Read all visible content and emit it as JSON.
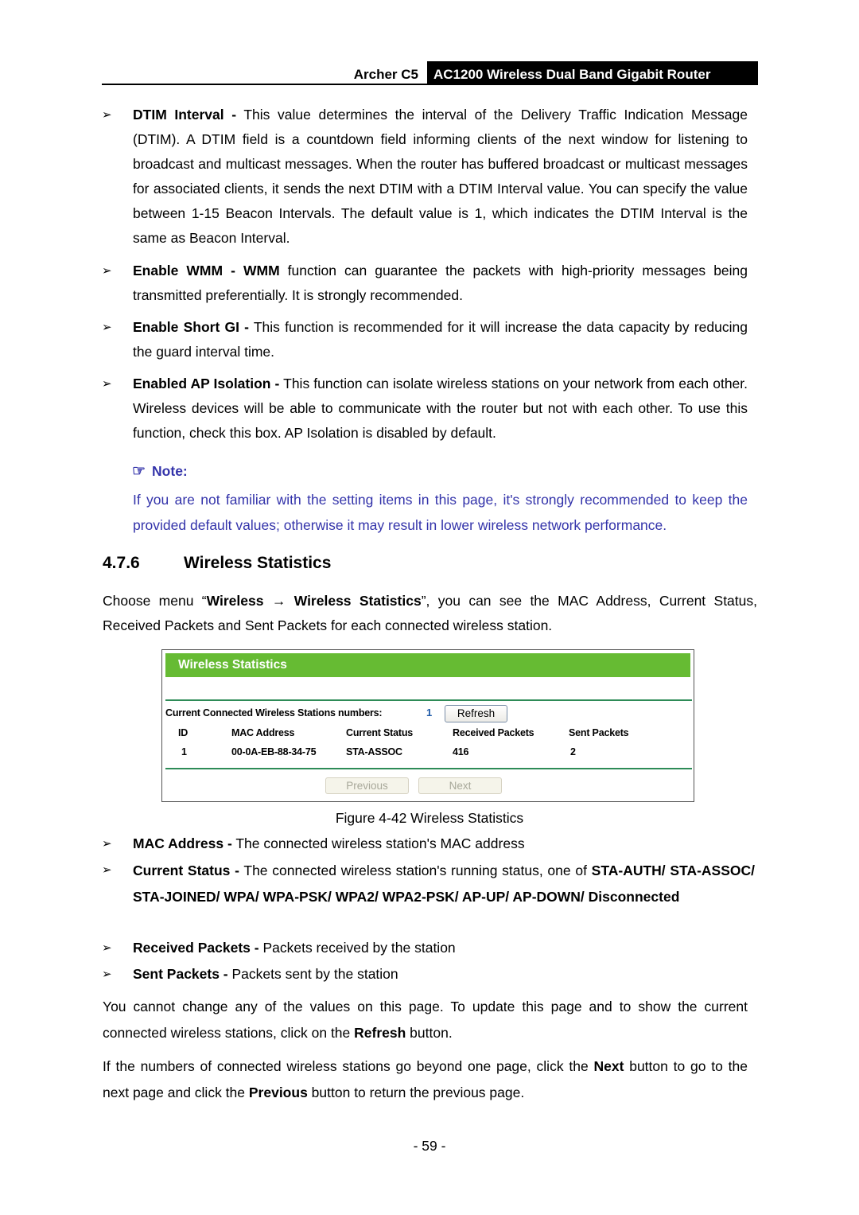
{
  "header": {
    "model": "Archer C5",
    "product": "AC1200 Wireless Dual Band Gigabit Router"
  },
  "bullets_top": [
    {
      "term": "DTIM Interval -",
      "text": " This value determines the interval of the Delivery Traffic Indication Message (DTIM). A DTIM field is a countdown field informing clients of the next window for listening to broadcast and multicast messages. When the router has buffered broadcast or multicast messages for associated clients, it sends the next DTIM with a DTIM Interval value. You can specify the value between 1-15 Beacon Intervals. The default value is 1, which indicates the DTIM Interval is the same as Beacon Interval."
    },
    {
      "term": "Enable WMM - WMM",
      "text": " function can guarantee the packets with high-priority messages being transmitted preferentially. It is strongly recommended."
    },
    {
      "term": "Enable Short GI -",
      "text": " This function is recommended for it will increase the data capacity by reducing the guard interval time."
    },
    {
      "term": "Enabled AP Isolation -",
      "text": " This function can isolate wireless stations on your network from each other. Wireless devices will be able to communicate with the router but not with each other. To use this function, check this box. AP Isolation is disabled by default."
    }
  ],
  "bullet_glyph": "➢",
  "note": {
    "icon": "☞",
    "title": "Note:",
    "text": "If you are not familiar with the setting items in this page, it's strongly recommended to keep the provided default values; otherwise it may result in lower wireless network performance.",
    "color": "#3333aa"
  },
  "section": {
    "number": "4.7.6",
    "title": "Wireless Statistics"
  },
  "intro": {
    "prefix": "Choose menu “",
    "menu_1": "Wireless",
    "arrow": " → ",
    "menu_2": "Wireless Statistics",
    "suffix": "”, you can see the MAC Address, Current Status, Received Packets and Sent Packets for each connected wireless station."
  },
  "figure": {
    "bar_title": "Wireless Statistics",
    "bar_color": "#66bb33",
    "count_label": "Current Connected Wireless Stations numbers:",
    "count_value": "1",
    "refresh_button": "Refresh",
    "columns": [
      "ID",
      "MAC Address",
      "Current Status",
      "Received Packets",
      "Sent Packets"
    ],
    "rows": [
      [
        "1",
        "00-0A-EB-88-34-75",
        "STA-ASSOC",
        "416",
        "2"
      ]
    ],
    "previous_button": "Previous",
    "next_button": "Next",
    "caption": "Figure 4-42 Wireless Statistics"
  },
  "bullets_bottom": [
    {
      "term": "MAC Address -",
      "text": " The connected wireless station's MAC address"
    },
    {
      "term": "Current Status -",
      "text": " The connected wireless station's running status, one of ",
      "tail_bold": "STA-AUTH/ STA-ASSOC/ STA-JOINED/ WPA/ WPA-PSK/ WPA2/ WPA2-PSK/ AP-UP/ AP-DOWN/ Disconnected"
    },
    {
      "term": "Received Packets -",
      "text": " Packets received by the station"
    },
    {
      "term": "Sent Packets -",
      "text": " Packets sent by the station"
    }
  ],
  "closing": {
    "p1_a": "You cannot change any of the values on this page. To update this page and to show the current connected wireless stations, click on the ",
    "p1_b": "Refresh",
    "p1_c": " button.",
    "p2_a": "If the numbers of connected wireless stations go beyond one page, click the ",
    "p2_b": "Next",
    "p2_c": " button to go to the next page and click the ",
    "p2_d": "Previous",
    "p2_e": " button to return the previous page."
  },
  "page_number": "- 59 -"
}
